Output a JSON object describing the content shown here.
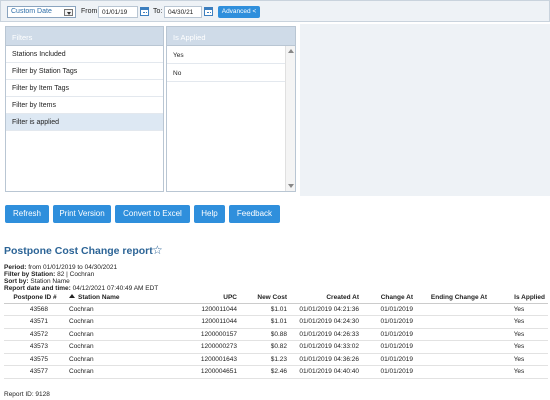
{
  "topbar": {
    "date_select": "Custom Date",
    "from_label": "From:",
    "from_value": "01/01/19",
    "to_label": "To:",
    "to_value": "04/30/21",
    "advanced_label": "Advanced <"
  },
  "filters": {
    "header": "Filters",
    "items": [
      "Stations Included",
      "Filter by Station Tags",
      "Filter by Item Tags",
      "Filter by Items",
      "Filter is applied"
    ]
  },
  "applied": {
    "header": "Is Applied",
    "items": [
      "Yes",
      "No"
    ]
  },
  "buttons": {
    "refresh": "Refresh",
    "print": "Print Version",
    "excel": "Convert to Excel",
    "help": "Help",
    "feedback": "Feedback"
  },
  "report": {
    "title": "Postpone Cost Change report",
    "period_label": "Period:",
    "period_value": "from 01/01/2019 to 04/30/2021",
    "station_label": "Filter by Station:",
    "station_value": "82 | Cochran",
    "sort_label": "Sort by:",
    "sort_value": "Station Name",
    "datetime_label": "Report date and time:",
    "datetime_value": "04/12/2021 07:40:49 AM EDT",
    "report_id": "Report ID: 9128"
  },
  "table": {
    "headers": [
      "Postpone ID #",
      "Station Name",
      "UPC",
      "New Cost",
      "Created At",
      "Change At",
      "Ending Change At",
      "Is Applied"
    ],
    "rows": [
      [
        "43568",
        "Cochran",
        "1200011044",
        "$1.01",
        "01/01/2019 04:21:36",
        "01/01/2019",
        "",
        "Yes"
      ],
      [
        "43571",
        "Cochran",
        "1200011044",
        "$1.01",
        "01/01/2019 04:24:30",
        "01/01/2019",
        "",
        "Yes"
      ],
      [
        "43572",
        "Cochran",
        "1200000157",
        "$0.88",
        "01/01/2019 04:26:33",
        "01/01/2019",
        "",
        "Yes"
      ],
      [
        "43573",
        "Cochran",
        "1200000273",
        "$0.82",
        "01/01/2019 04:33:02",
        "01/01/2019",
        "",
        "Yes"
      ],
      [
        "43575",
        "Cochran",
        "1200001643",
        "$1.23",
        "01/01/2019 04:36:26",
        "01/01/2019",
        "",
        "Yes"
      ],
      [
        "43577",
        "Cochran",
        "1200004651",
        "$2.46",
        "01/01/2019 04:40:40",
        "01/01/2019",
        "",
        "Yes"
      ]
    ]
  }
}
